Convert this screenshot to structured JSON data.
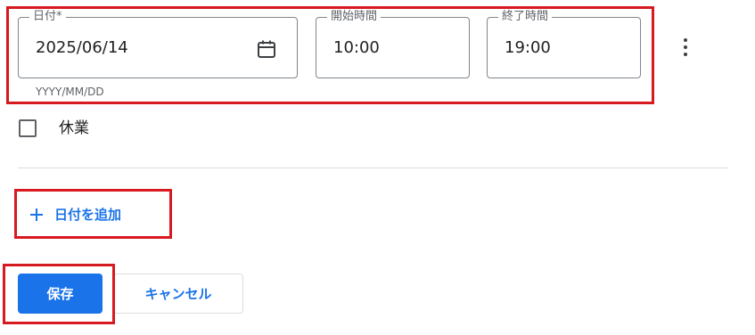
{
  "colors": {
    "accent": "#1a73e8",
    "highlight_red": "#d71920"
  },
  "date_field": {
    "label": "日付*",
    "value": "2025/06/14",
    "helper": "YYYY/MM/DD",
    "icon": "calendar-icon"
  },
  "start_time_field": {
    "label": "開始時間",
    "value": "10:00"
  },
  "end_time_field": {
    "label": "終了時間",
    "value": "19:00"
  },
  "more_menu": {
    "icon": "more-vert-icon"
  },
  "closed_checkbox": {
    "label": "休業",
    "checked": false
  },
  "add_date": {
    "icon": "plus-icon",
    "label": "日付を追加"
  },
  "actions": {
    "save_label": "保存",
    "cancel_label": "キャンセル"
  }
}
